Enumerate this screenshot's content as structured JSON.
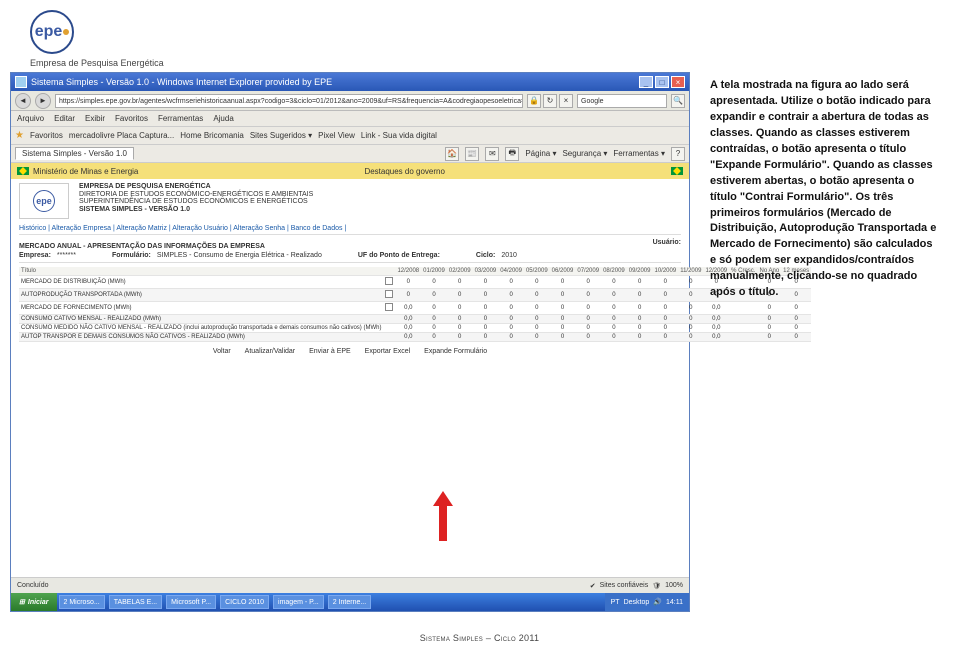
{
  "logo": {
    "text": "epe",
    "caption": "Empresa de Pesquisa Energética"
  },
  "browser": {
    "title": "Sistema Simples - Versão 1.0 - Windows Internet Explorer provided by EPE",
    "url": "https://simples.epe.gov.br/agentes/wcfrmseriehistoricaanual.aspx?codigo=3&ciclo=01/2012&ano=2009&uf=RS&frequencia=A&codregiaopesoeletrica=5I",
    "search": "Google",
    "menus": [
      "Arquivo",
      "Editar",
      "Exibir",
      "Favoritos",
      "Ferramentas",
      "Ajuda"
    ],
    "favorites_label": "Favoritos",
    "fav_links": [
      "mercadolivre Placa Captura...",
      "Home Bricomania",
      "Sites Sugeridos ▾",
      "Pixel View",
      "Link - Sua vida digital"
    ],
    "tab_label": "Sistema Simples - Versão 1.0",
    "tab_tools": [
      "Página ▾",
      "Segurança ▾",
      "Ferramentas ▾"
    ],
    "status_left": "Concluído",
    "status_zone": "Sites confiáveis",
    "status_zoom": "100%"
  },
  "gov_bar": {
    "ministry": "Ministério de Minas e Energia",
    "destaques": "Destaques do governo"
  },
  "epe_header": {
    "line1": "EMPRESA DE PESQUISA ENERGÉTICA",
    "line2": "DIRETORIA DE ESTUDOS ECONÔMICO-ENERGÉTICOS E AMBIENTAIS",
    "line3": "SUPERINTENDÊNCIA DE ESTUDOS ECONÔMICOS E ENERGÉTICOS",
    "line4": "SISTEMA SIMPLES - VERSÃO 1.0"
  },
  "nav_links": "Histórico | Alteração Empresa | Alteração Matriz | Alteração Usuário | Alteração Senha | Banco de Dados |",
  "section": {
    "title": "MERCADO ANUAL - APRESENTAÇÃO DAS INFORMAÇÕES DA EMPRESA",
    "usuario_lbl": "Usuário:",
    "empresa_lbl": "Empresa:",
    "empresa_val": "*******",
    "form_lbl": "Formulário:",
    "form_val": "SIMPLES - Consumo de Energia Elétrica - Realizado",
    "uf_lbl": "UF do Ponto de Entrega:",
    "ciclo_lbl": "Ciclo:",
    "ciclo_val": "2010"
  },
  "table": {
    "head": [
      "Título",
      "",
      "12/2008",
      "01/2009",
      "02/2009",
      "03/2009",
      "04/2009",
      "05/2009",
      "06/2009",
      "07/2009",
      "08/2009",
      "09/2009",
      "10/2009",
      "11/2009",
      "12/2009",
      "% Cresc.",
      "No Ano",
      "12 meses"
    ],
    "rows": [
      {
        "t": "MERCADO DE DISTRIBUIÇÃO (MWh)",
        "chk": true,
        "v": [
          "0",
          "0",
          "0",
          "0",
          "0",
          "0",
          "0",
          "0",
          "0",
          "0",
          "0",
          "0",
          "0",
          "",
          "0",
          "0"
        ]
      },
      {
        "t": "AUTOPRODUÇÃO TRANSPORTADA (MWh)",
        "chk": true,
        "v": [
          "0",
          "0",
          "0",
          "0",
          "0",
          "0",
          "0",
          "0",
          "0",
          "0",
          "0",
          "0",
          "0",
          "",
          "0",
          "0"
        ]
      },
      {
        "t": "MERCADO DE FORNECIMENTO (MWh)",
        "chk": true,
        "v": [
          "0,0",
          "0",
          "0",
          "0",
          "0",
          "0",
          "0",
          "0",
          "0",
          "0",
          "0",
          "0",
          "0,0",
          "",
          "0",
          "0"
        ]
      },
      {
        "t": "CONSUMO CATIVO MENSAL - REALIZADO (MWh)",
        "chk": false,
        "v": [
          "0,0",
          "0",
          "0",
          "0",
          "0",
          "0",
          "0",
          "0",
          "0",
          "0",
          "0",
          "0",
          "0,0",
          "",
          "0",
          "0"
        ]
      },
      {
        "t": "CONSUMO MEDIDO NÃO CATIVO MENSAL - REALIZADO (inclui autoprodução transportada e demais consumos não cativos) (MWh)",
        "chk": false,
        "v": [
          "0,0",
          "0",
          "0",
          "0",
          "0",
          "0",
          "0",
          "0",
          "0",
          "0",
          "0",
          "0",
          "0,0",
          "",
          "0",
          "0"
        ]
      },
      {
        "t": "AUTOP TRANSPOR E DEMAIS CONSUMOS NÃO CATIVOS - REALIZADO (MWh)",
        "chk": false,
        "v": [
          "0,0",
          "0",
          "0",
          "0",
          "0",
          "0",
          "0",
          "0",
          "0",
          "0",
          "0",
          "0",
          "0,0",
          "",
          "0",
          "0"
        ]
      }
    ]
  },
  "actions": {
    "voltar": "Voltar",
    "atualizar": "Atualizar/Validar",
    "enviar": "Enviar à EPE",
    "exportar": "Exportar Excel",
    "expande": "Expande Formulário"
  },
  "taskbar": {
    "start": "Iniciar",
    "items": [
      "2 Microso...",
      "TABELAS E...",
      "Microsoft P...",
      "CICLO 2010",
      "imagem - P...",
      "2 Interne..."
    ],
    "lang": "PT",
    "desk": "Desktop",
    "clock": "14:11"
  },
  "side_text": "A tela mostrada na figura ao lado será apresentada. Utilize o botão indicado para expandir e contrair a abertura de todas as classes. Quando as classes estiverem contraídas, o botão apresenta o título \"Expande Formulário\". Quando as classes estiverem abertas, o botão apresenta o título \"Contrai Formulário\". Os três primeiros formulários (Mercado de Distribuição, Autoprodução Transportada e Mercado de Fornecimento) são calculados e só podem ser expandidos/contraídos manualmente, clicando-se no quadrado após o título.",
  "footer": "Sistema Simples – Ciclo 2011"
}
